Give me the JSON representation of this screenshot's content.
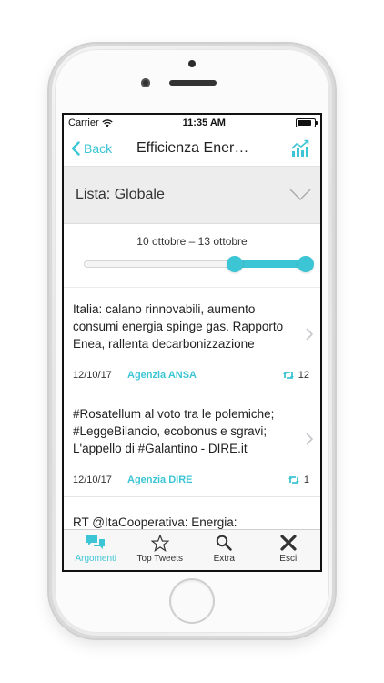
{
  "status": {
    "carrier": "Carrier",
    "time": "11:35 AM",
    "battery_level": 0.85
  },
  "nav": {
    "back_label": "Back",
    "title": "Efficienza Ener…",
    "chart_icon": "chart-trend-icon"
  },
  "list": {
    "label": "Lista: Globale",
    "icon": "chevron-down-icon"
  },
  "range": {
    "label": "10 ottobre – 13 ottobre",
    "start": 0.68,
    "end": 1.0
  },
  "tweets": [
    {
      "text": "Italia: calano rinnovabili, aumento consumi energia spinge gas. Rapporto Enea, rallenta decarbonizzazione",
      "date": "12/10/17",
      "source": "Agenzia ANSA",
      "retweets": "12"
    },
    {
      "text": "#Rosatellum al voto tra le polemiche; #LeggeBilancio, ecobonus e sgravi; L'appello di #Galantino - DIRE.it",
      "date": "12/10/17",
      "source": "Agenzia DIRE",
      "retweets": "1"
    },
    {
      "text": "RT @ItaCooperativa: Energia:",
      "date": "",
      "source": "",
      "retweets": ""
    }
  ],
  "tabs": [
    {
      "label": "Argomenti",
      "icon": "speech-bubbles-icon",
      "active": true
    },
    {
      "label": "Top Tweets",
      "icon": "star-icon",
      "active": false
    },
    {
      "label": "Extra",
      "icon": "search-icon",
      "active": false
    },
    {
      "label": "Esci",
      "icon": "close-icon",
      "active": false
    }
  ],
  "colors": {
    "accent": "#3cc5d4"
  }
}
